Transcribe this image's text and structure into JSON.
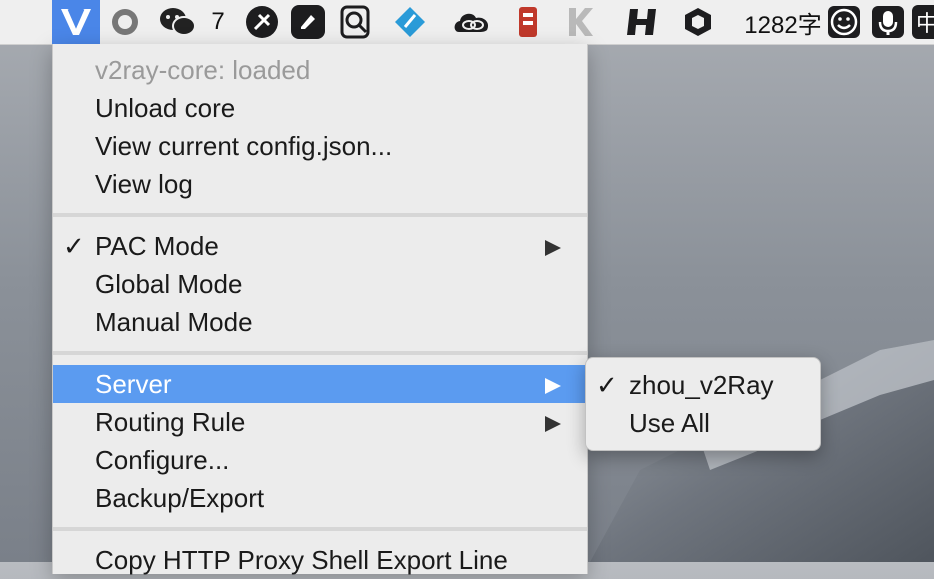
{
  "menubar": {
    "v2ray_icon": "v2ray-icon",
    "items": [
      {
        "icon": "v2rayx-status-icon"
      },
      {
        "icon": "wechat-icon",
        "badge": "7"
      },
      {
        "icon": "git-icon"
      },
      {
        "icon": "note-icon"
      },
      {
        "icon": "search-doc-icon"
      },
      {
        "icon": "feather-icon"
      },
      {
        "icon": "creative-cloud-icon"
      },
      {
        "icon": "dictionary-icon"
      },
      {
        "icon": "k-icon"
      },
      {
        "icon": "h-icon"
      },
      {
        "icon": "hexagon-icon"
      }
    ],
    "word_count": "1282字",
    "input_method": "中"
  },
  "menu": {
    "status": "v2ray-core: loaded",
    "unload_core": "Unload core",
    "view_config": "View current config.json...",
    "view_log": "View log",
    "pac_mode": "PAC Mode",
    "global_mode": "Global Mode",
    "manual_mode": "Manual Mode",
    "server": "Server",
    "routing_rule": "Routing Rule",
    "configure": "Configure...",
    "backup_export": "Backup/Export",
    "copy_proxy": "Copy HTTP Proxy Shell Export Line",
    "checkmark": "✓"
  },
  "submenu": {
    "server_name": "zhou_v2Ray",
    "use_all": "Use All",
    "checkmark": "✓"
  },
  "colors": {
    "selection": "#5b9bf0",
    "menu_bg": "#ececec",
    "menubar_bg": "#efefef"
  }
}
